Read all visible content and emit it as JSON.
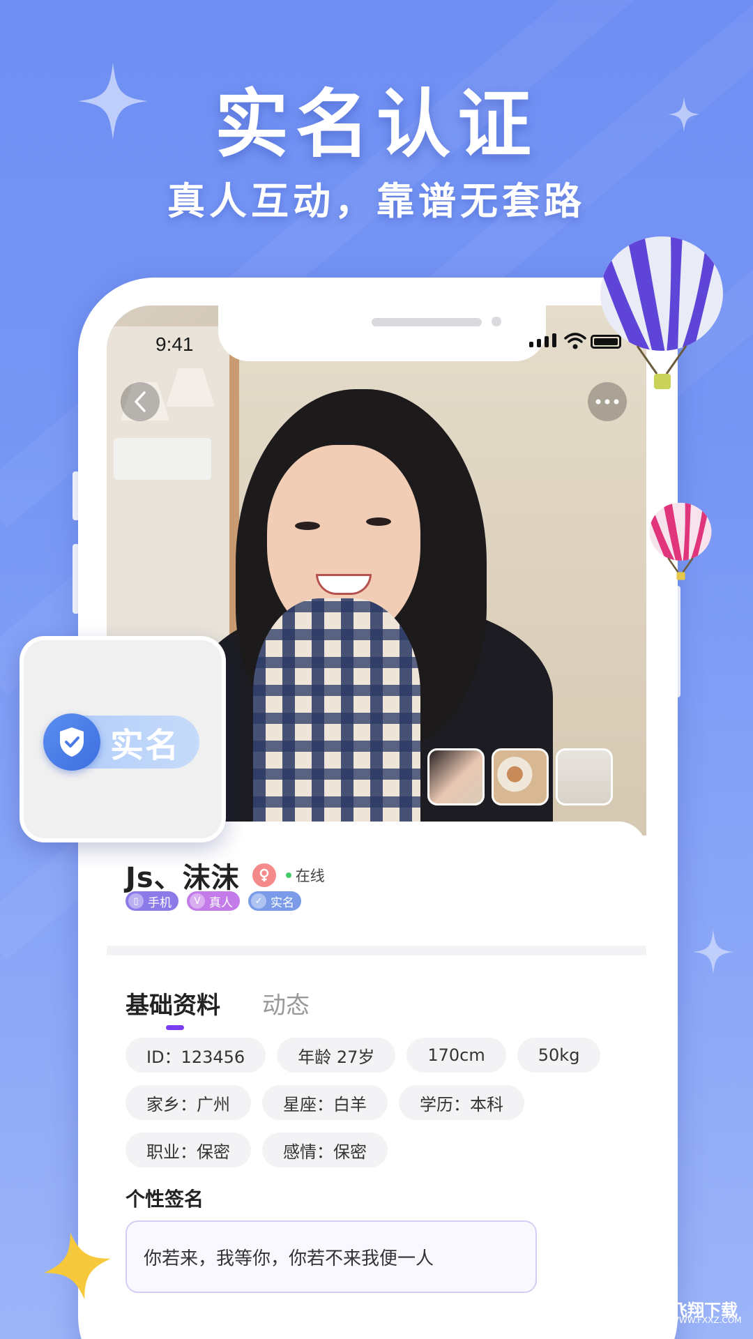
{
  "hero": {
    "headline": "实名认证",
    "subline": "真人互动，靠谱无套路"
  },
  "status_bar": {
    "time": "9:41"
  },
  "profile": {
    "name": "Js、沫沫",
    "online_text": "在线",
    "badges": [
      {
        "label": "手机",
        "icon": "phone-icon",
        "color": "#8b7be8"
      },
      {
        "label": "真人",
        "icon": "v-icon",
        "color": "#c27be8"
      },
      {
        "label": "实名",
        "icon": "check-shield-icon",
        "color": "#7b9be8"
      }
    ],
    "tabs": [
      {
        "label": "基础资料",
        "active": true
      },
      {
        "label": "动态",
        "active": false
      }
    ],
    "tags": [
      "ID：123456",
      "年龄 27岁",
      "170cm",
      "50kg",
      "家乡：广州",
      "星座：白羊",
      "学历：本科",
      "职业：保密",
      "感情：保密"
    ],
    "signature_title": "个性签名",
    "signature": "你若来，我等你，你若不来我便一人"
  },
  "badge_card": {
    "label": "实名"
  },
  "watermark": {
    "cn": "飞翔下载",
    "url": "WWW.FXXZ.COM"
  },
  "colors": {
    "background": "#7797f5",
    "accent": "#7b3cf2",
    "online": "#45cc6a"
  }
}
